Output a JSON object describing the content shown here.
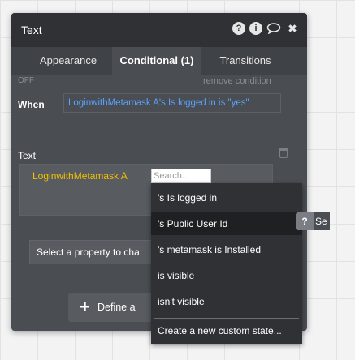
{
  "panel": {
    "title": "Text",
    "header_icons": [
      {
        "name": "help-icon",
        "glyph": "?"
      },
      {
        "name": "info-icon",
        "glyph": "i"
      },
      {
        "name": "comment-icon",
        "glyph": "○"
      },
      {
        "name": "close-icon",
        "glyph": "✖"
      }
    ]
  },
  "tabs": [
    {
      "label": "Appearance",
      "active": false
    },
    {
      "label": "Conditional (1)",
      "active": true
    },
    {
      "label": "Transitions",
      "active": false
    }
  ],
  "condition": {
    "state": "OFF",
    "remove_label": "remove condition",
    "when_label": "When",
    "expression": "LoginwithMetamask A's Is logged in is \"yes\""
  },
  "text_property": {
    "label": "Text",
    "dynamic_source": "LoginwithMetamask A",
    "search_placeholder": "Search..."
  },
  "select_property": {
    "label": "Select a property to cha"
  },
  "define_button": {
    "icon": "plus-icon",
    "label": "Define a"
  },
  "dropdown": {
    "items": [
      {
        "label": "'s Is logged in"
      },
      {
        "label": "'s Public User Id",
        "highlighted": true
      },
      {
        "label": "'s metamask is Installed"
      },
      {
        "label": " is visible"
      },
      {
        "label": " isn't visible"
      }
    ],
    "footer_action": "Create a new custom state..."
  },
  "help_tooltip": {
    "glyph": "?",
    "label": "Se"
  },
  "colors": {
    "panel_bg": "#4a4d52",
    "header_bg": "#2f3134",
    "link_blue": "#5aa2ff",
    "dynamic_yellow": "#f0c000",
    "dropdown_bg": "#2f3134"
  }
}
